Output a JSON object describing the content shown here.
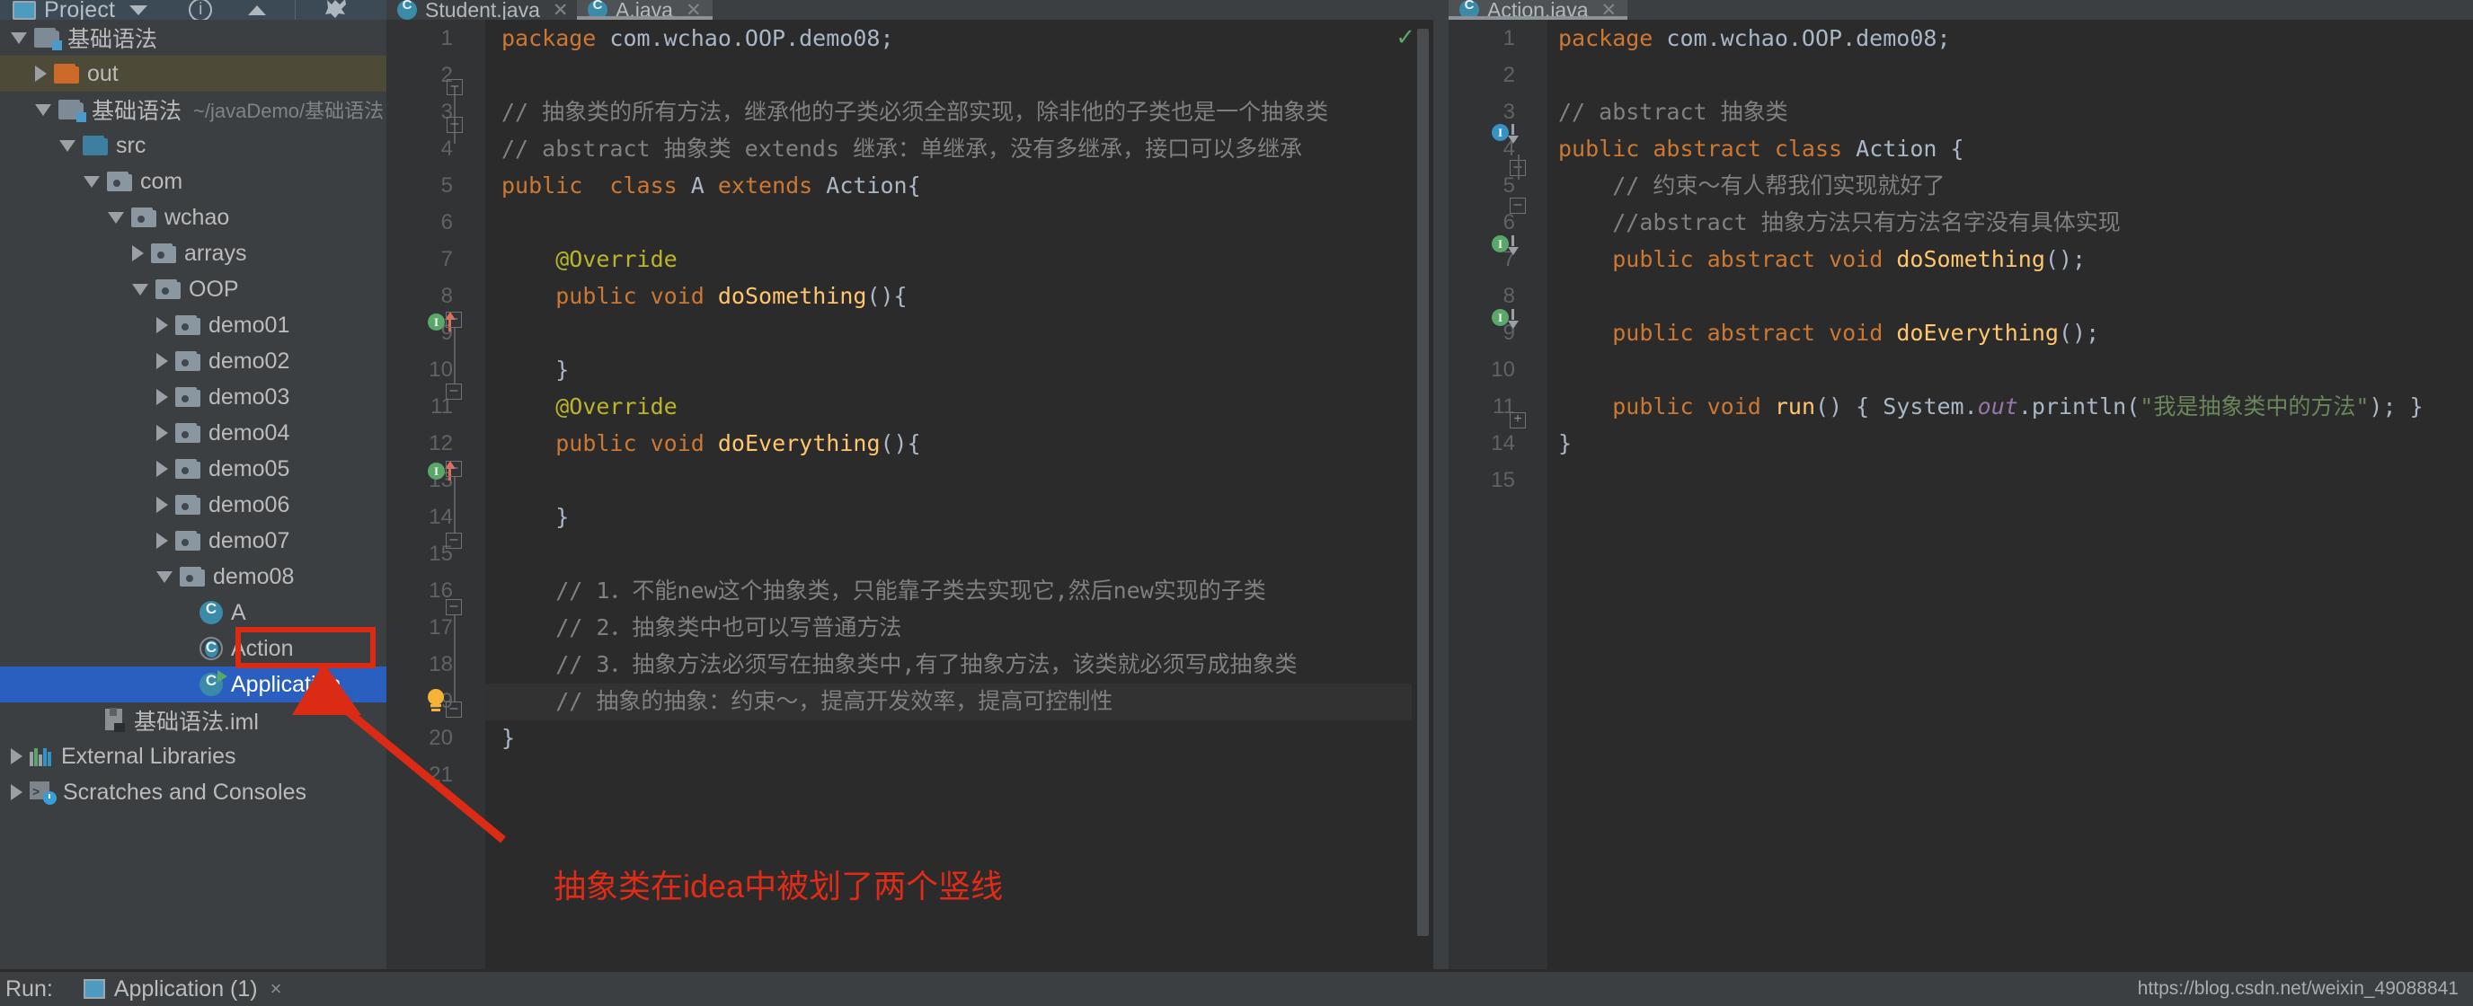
{
  "toolbar": {
    "project_label": "Project",
    "project_icon": "project-window-icon",
    "dropdown_icon": "chevron-down-icon",
    "help_icon": "help-circle-icon",
    "collapse_icon": "chevron-up-icon",
    "settings_icon": "gear-icon"
  },
  "sidebar": {
    "items": [
      {
        "label": "基础语法",
        "icon": "module-folder-icon",
        "indent": 0,
        "arrow": "down",
        "path": "",
        "state": "normal"
      },
      {
        "label": "out",
        "icon": "excluded-folder-icon",
        "indent": 1,
        "arrow": "right",
        "path": "",
        "state": "highlight"
      },
      {
        "label": "基础语法",
        "icon": "module-folder-icon",
        "indent": 1,
        "arrow": "down",
        "path": "~/javaDemo/基础语法",
        "state": "normal"
      },
      {
        "label": "src",
        "icon": "source-folder-icon",
        "indent": 2,
        "arrow": "down",
        "path": "",
        "state": "normal"
      },
      {
        "label": "com",
        "icon": "package-icon",
        "indent": 3,
        "arrow": "down",
        "path": "",
        "state": "normal"
      },
      {
        "label": "wchao",
        "icon": "package-icon",
        "indent": 4,
        "arrow": "down",
        "path": "",
        "state": "normal"
      },
      {
        "label": "arrays",
        "icon": "package-icon",
        "indent": 5,
        "arrow": "right",
        "path": "",
        "state": "normal"
      },
      {
        "label": "OOP",
        "icon": "package-icon",
        "indent": 5,
        "arrow": "down",
        "path": "",
        "state": "normal"
      },
      {
        "label": "demo01",
        "icon": "package-icon",
        "indent": 6,
        "arrow": "right",
        "path": "",
        "state": "normal"
      },
      {
        "label": "demo02",
        "icon": "package-icon",
        "indent": 6,
        "arrow": "right",
        "path": "",
        "state": "normal"
      },
      {
        "label": "demo03",
        "icon": "package-icon",
        "indent": 6,
        "arrow": "right",
        "path": "",
        "state": "normal"
      },
      {
        "label": "demo04",
        "icon": "package-icon",
        "indent": 6,
        "arrow": "right",
        "path": "",
        "state": "normal"
      },
      {
        "label": "demo05",
        "icon": "package-icon",
        "indent": 6,
        "arrow": "right",
        "path": "",
        "state": "normal"
      },
      {
        "label": "demo06",
        "icon": "package-icon",
        "indent": 6,
        "arrow": "right",
        "path": "",
        "state": "normal"
      },
      {
        "label": "demo07",
        "icon": "package-icon",
        "indent": 6,
        "arrow": "right",
        "path": "",
        "state": "normal"
      },
      {
        "label": "demo08",
        "icon": "package-icon",
        "indent": 6,
        "arrow": "down",
        "path": "",
        "state": "normal"
      },
      {
        "label": "A",
        "icon": "java-class-icon",
        "indent": 7,
        "arrow": "none",
        "path": "",
        "state": "normal"
      },
      {
        "label": "Action",
        "icon": "abstract-class-icon",
        "indent": 7,
        "arrow": "none",
        "path": "",
        "state": "normal"
      },
      {
        "label": "Application",
        "icon": "runnable-class-icon",
        "indent": 7,
        "arrow": "none",
        "path": "",
        "state": "selected"
      },
      {
        "label": "基础语法.iml",
        "icon": "iml-file-icon",
        "indent": 3,
        "arrow": "none",
        "path": "",
        "state": "normal"
      },
      {
        "label": "External Libraries",
        "icon": "external-libraries-icon",
        "indent": 0,
        "arrow": "right",
        "path": "",
        "state": "normal"
      },
      {
        "label": "Scratches and Consoles",
        "icon": "scratches-icon",
        "indent": 0,
        "arrow": "right",
        "path": "",
        "state": "normal"
      }
    ]
  },
  "editor_left": {
    "tabs": [
      {
        "label": "Student.java",
        "active": false,
        "icon": "java-class-icon",
        "close_icon": "close-icon"
      },
      {
        "label": "A.java",
        "active": true,
        "icon": "java-class-icon",
        "close_icon": "close-icon"
      }
    ],
    "inspection_ok_glyph": "✓",
    "lines": [
      {
        "n": "1",
        "html": "<span class=\"k\">package</span> com.wchao.OOP.demo08<span class=\"pn\">;</span>"
      },
      {
        "n": "2",
        "html": ""
      },
      {
        "n": "3",
        "html": "<span class=\"cm\">// 抽象类的所有方法，继承他的子类必须全部实现，除非他的子类也是一个抽象类</span>"
      },
      {
        "n": "4",
        "html": "<span class=\"cm\">// abstract 抽象类 extends 继承：单继承，没有多继承，接口可以多继承</span>"
      },
      {
        "n": "5",
        "html": "<span class=\"k\">public</span>  <span class=\"k\">class</span> <span class=\"cls\">A</span> <span class=\"k\">extends</span> <span class=\"cls\">Action</span>{"
      },
      {
        "n": "6",
        "html": ""
      },
      {
        "n": "7",
        "html": "    <span class=\"an\">@Override</span>"
      },
      {
        "n": "8",
        "html": "    <span class=\"k\">public</span> <span class=\"k\">void</span> <span class=\"mt\">doSomething</span>(){"
      },
      {
        "n": "9",
        "html": ""
      },
      {
        "n": "10",
        "html": "    }"
      },
      {
        "n": "11",
        "html": "    <span class=\"an\">@Override</span>"
      },
      {
        "n": "12",
        "html": "    <span class=\"k\">public</span> <span class=\"k\">void</span> <span class=\"mt\">doEverything</span>(){"
      },
      {
        "n": "13",
        "html": ""
      },
      {
        "n": "14",
        "html": "    }"
      },
      {
        "n": "15",
        "html": ""
      },
      {
        "n": "16",
        "html": "    <span class=\"cm\">// 1．不能new这个抽象类，只能靠子类去实现它,然后new实现的子类</span>"
      },
      {
        "n": "17",
        "html": "    <span class=\"cm\">// 2．抽象类中也可以写普通方法</span>"
      },
      {
        "n": "18",
        "html": "    <span class=\"cm\">// 3．抽象方法必须写在抽象类中,有了抽象方法，该类就必须写成抽象类</span>"
      },
      {
        "n": "19",
        "html": "    <span class=\"cm\">// 抽象的抽象：约束～，提高开发效率，提高可控制性</span>"
      },
      {
        "n": "20",
        "html": "}"
      },
      {
        "n": "21",
        "html": ""
      }
    ],
    "current_line": "19"
  },
  "editor_right": {
    "tabs": [
      {
        "label": "Action.java",
        "active": true,
        "icon": "java-class-icon",
        "close_icon": "close-icon"
      }
    ],
    "lines": [
      {
        "n": "1",
        "html": "<span class=\"k\">package</span> com.wchao.OOP.demo08<span class=\"pn\">;</span>"
      },
      {
        "n": "2",
        "html": ""
      },
      {
        "n": "3",
        "html": "<span class=\"cm\">// abstract 抽象类</span>"
      },
      {
        "n": "4",
        "html": "<span class=\"k\">public abstract class</span> <span class=\"cls\">Action</span> {"
      },
      {
        "n": "5",
        "html": "    <span class=\"cm\">// 约束～有人帮我们实现就好了</span>"
      },
      {
        "n": "6",
        "html": "    <span class=\"cm\">//abstract 抽象方法只有方法名字没有具体实现</span>"
      },
      {
        "n": "7",
        "html": "    <span class=\"k\">public abstract</span> <span class=\"k\">void</span> <span class=\"mt\">doSomething</span>();"
      },
      {
        "n": "8",
        "html": ""
      },
      {
        "n": "9",
        "html": "    <span class=\"k\">public abstract</span> <span class=\"k\">void</span> <span class=\"mt\">doEverything</span>();"
      },
      {
        "n": "10",
        "html": ""
      },
      {
        "n": "11",
        "html": "    <span class=\"k\">public</span> <span class=\"k\">void</span> <span class=\"mt\">run</span>() { System.<span class=\"fld\">out</span>.println(<span class=\"st\">\"我是抽象类中的方法\"</span>); }"
      },
      {
        "n": "14",
        "html": "}"
      },
      {
        "n": "15",
        "html": ""
      }
    ]
  },
  "annotation": {
    "text": "抽象类在idea中被划了两个竖线",
    "color": "#e02b17",
    "box_target": "Action",
    "arrow_icon": "pointer-arrow-icon"
  },
  "bottom": {
    "run_label": "Run:",
    "config_label": "Application (1)",
    "config_icon": "run-config-icon",
    "close_icon": "×",
    "watermark": "https://blog.csdn.net/weixin_49088841"
  },
  "colors": {
    "accent_blue": "#2a5fc0",
    "editor_bg": "#2b2b2b",
    "gutter_bg": "#313335",
    "panel_bg": "#3c3f41",
    "keyword": "#cc7832",
    "comment": "#808080",
    "string": "#6a8759",
    "method": "#ffc66d",
    "annotation": "#bbb529",
    "red_marker": "#dc2b15"
  }
}
